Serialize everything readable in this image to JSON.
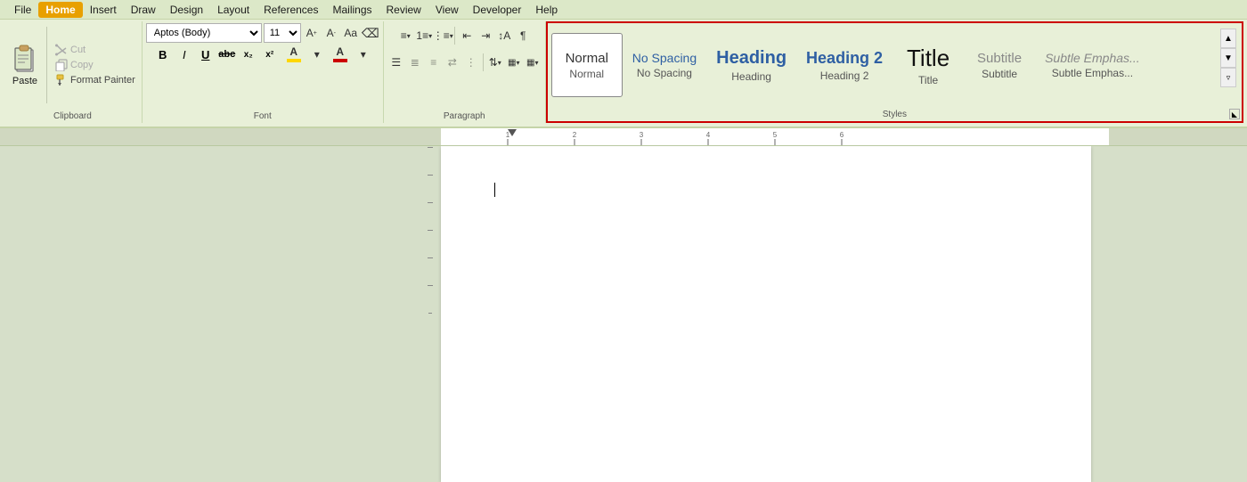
{
  "menubar": {
    "items": [
      "File",
      "Home",
      "Insert",
      "Draw",
      "Design",
      "Layout",
      "References",
      "Mailings",
      "Review",
      "View",
      "Developer",
      "Help"
    ]
  },
  "clipboard": {
    "paste_label": "Paste",
    "cut_label": "Cut",
    "copy_label": "Copy",
    "format_painter_label": "Format Painter",
    "group_label": "Clipboard"
  },
  "font": {
    "family": "Aptos (Body)",
    "size": "11",
    "group_label": "Font"
  },
  "paragraph": {
    "group_label": "Paragraph"
  },
  "styles": {
    "group_label": "Styles",
    "items": [
      {
        "id": "normal",
        "display": "Normal",
        "label": "Normal",
        "active": true
      },
      {
        "id": "no-spacing",
        "display": "No Spacing",
        "label": "No Spacing"
      },
      {
        "id": "heading1",
        "display": "Heading",
        "label": "Heading"
      },
      {
        "id": "heading2",
        "display": "Heading 2",
        "label": "Heading 2"
      },
      {
        "id": "title",
        "display": "Title",
        "label": "Title"
      },
      {
        "id": "subtitle",
        "display": "Subtitle",
        "label": "Subtitle"
      },
      {
        "id": "subtle-emph",
        "display": "Subtle Emphas...",
        "label": "Subtle Emphas..."
      }
    ]
  }
}
